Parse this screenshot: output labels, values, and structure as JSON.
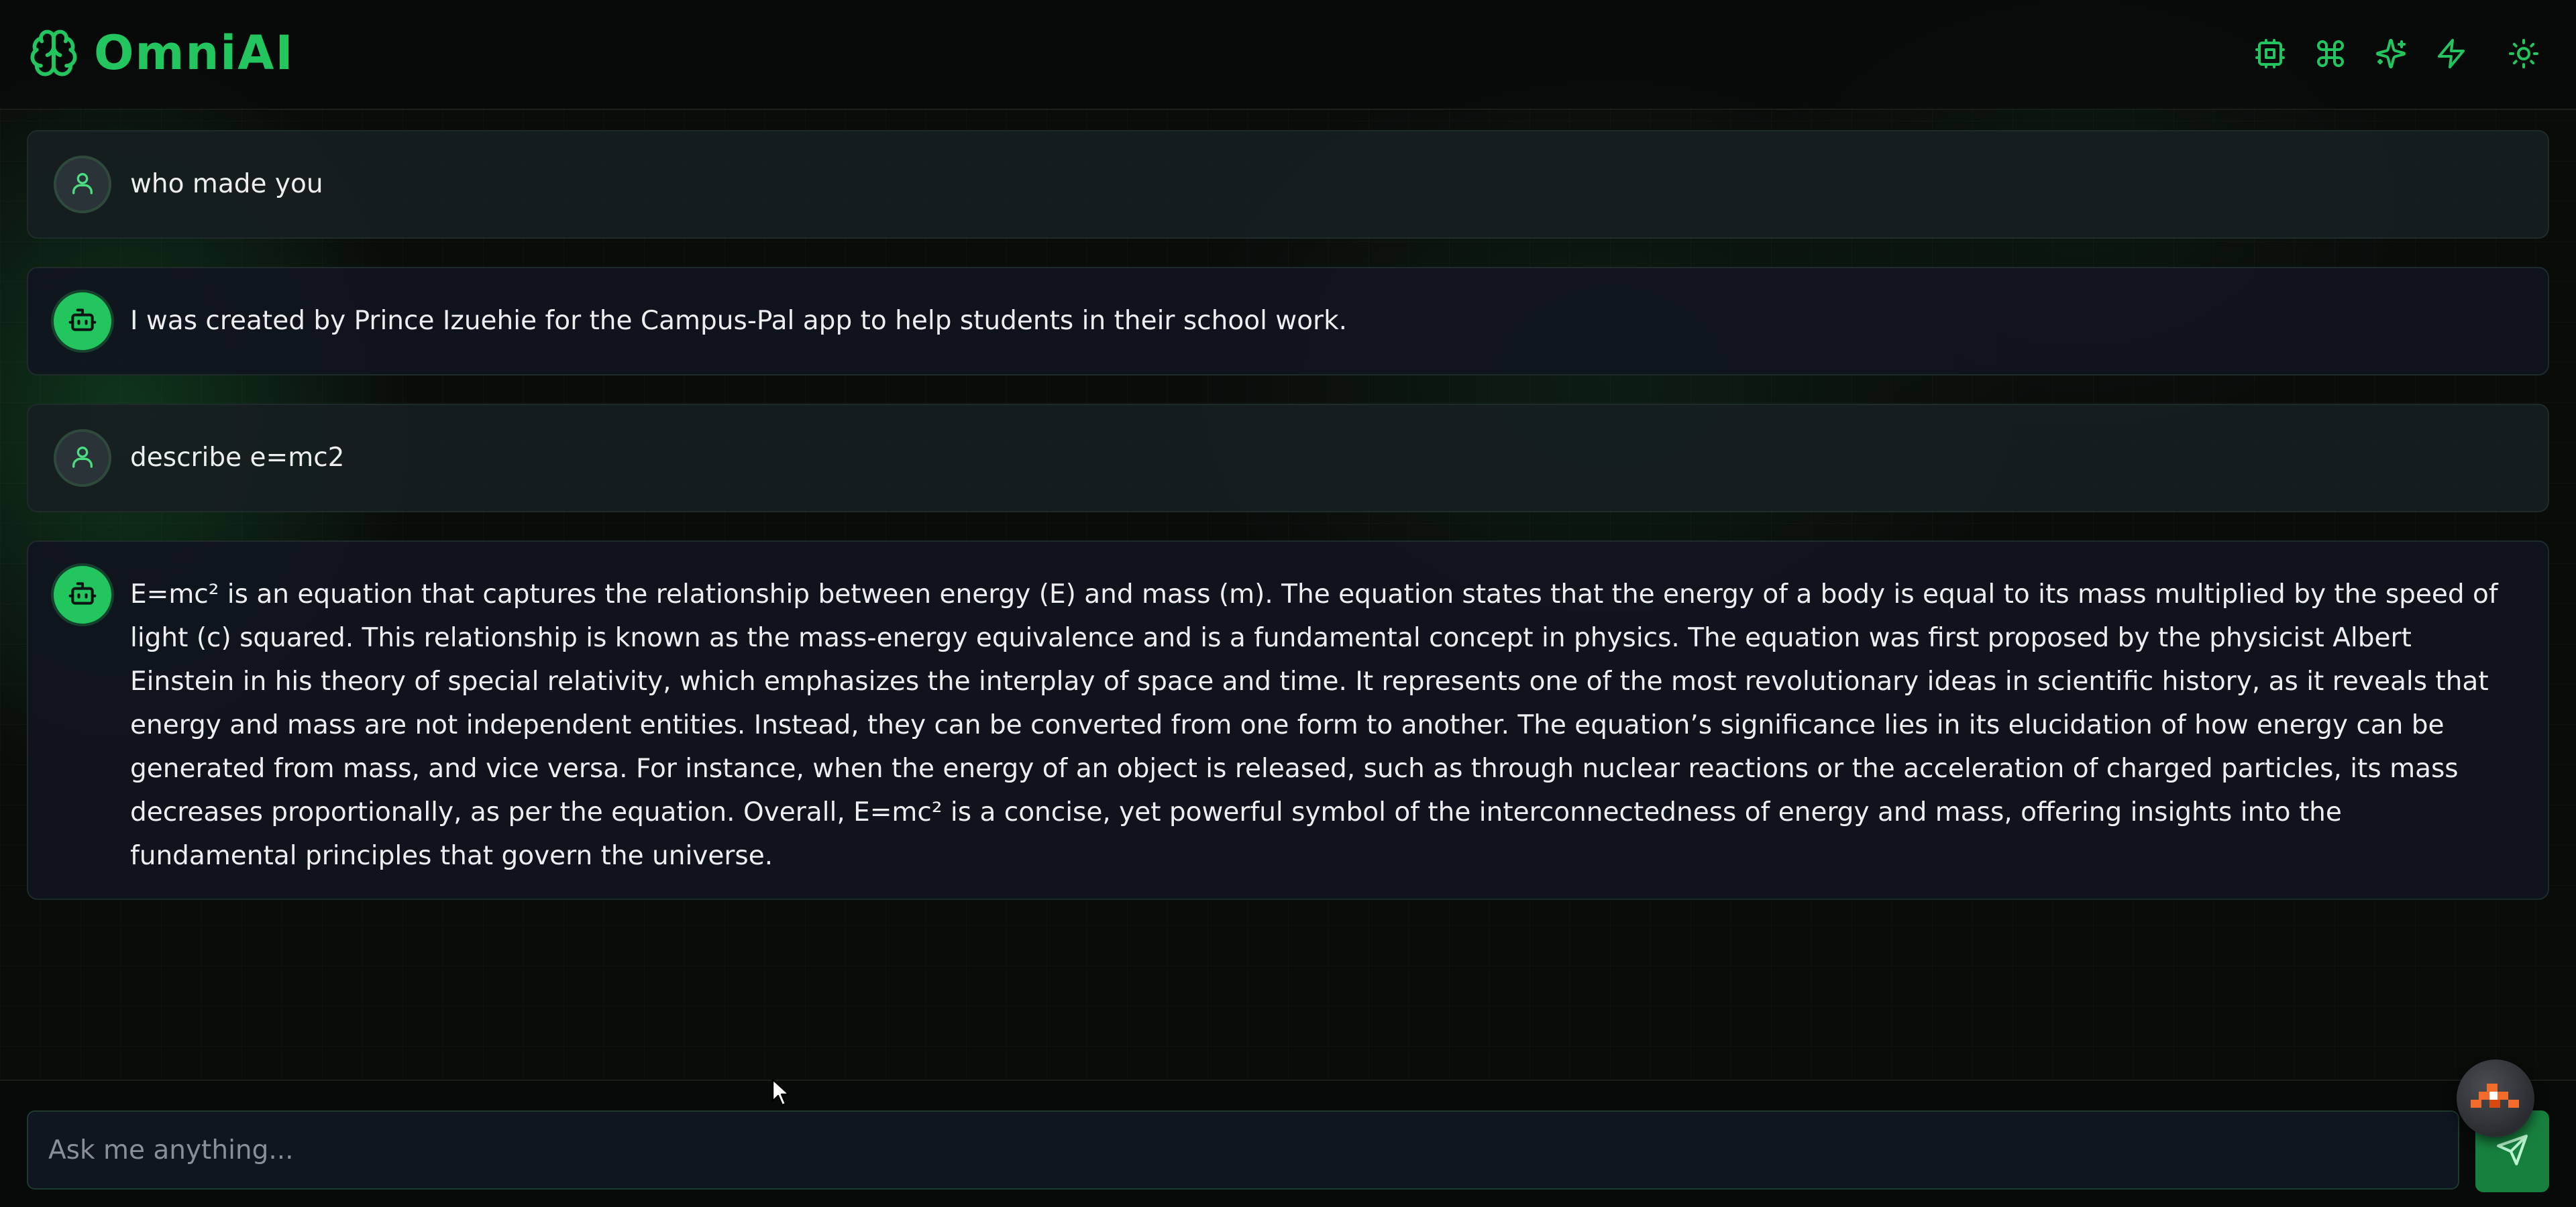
{
  "app": {
    "name": "OmniAI",
    "brand_icon": "brain-icon",
    "accent_color": "#22c55e"
  },
  "header": {
    "actions": [
      {
        "name": "cpu-icon"
      },
      {
        "name": "command-icon"
      },
      {
        "name": "sparkles-icon"
      },
      {
        "name": "lightning-icon"
      },
      {
        "name": "sun-icon"
      }
    ]
  },
  "messages": [
    {
      "role": "user",
      "avatar_icon": "user-icon",
      "text": "who made you"
    },
    {
      "role": "bot",
      "avatar_icon": "bot-icon",
      "text": "I was created by Prince Izuehie for the Campus-Pal app to help students in their school work."
    },
    {
      "role": "user",
      "avatar_icon": "user-icon",
      "text": "describe e=mc2"
    },
    {
      "role": "bot",
      "avatar_icon": "bot-icon",
      "text": "E=mc² is an equation that captures the relationship between energy (E) and mass (m). The equation states that the energy of a body is equal to its mass multiplied by the speed of light (c) squared. This relationship is known as the mass-energy equivalence and is a fundamental concept in physics. The equation was first proposed by the physicist Albert Einstein in his theory of special relativity, which emphasizes the interplay of space and time. It represents one of the most revolutionary ideas in scientific history, as it reveals that energy and mass are not independent entities. Instead, they can be converted from one form to another. The equation’s significance lies in its elucidation of how energy can be generated from mass, and vice versa. For instance, when the energy of an object is released, such as through nuclear reactions or the acceleration of charged particles, its mass decreases proportionally, as per the equation. Overall, E=mc² is a concise, yet powerful symbol of the interconnectedness of energy and mass, offering insights into the fundamental principles that govern the universe."
    }
  ],
  "composer": {
    "placeholder": "Ask me anything...",
    "value": "",
    "send_icon": "send-icon"
  }
}
